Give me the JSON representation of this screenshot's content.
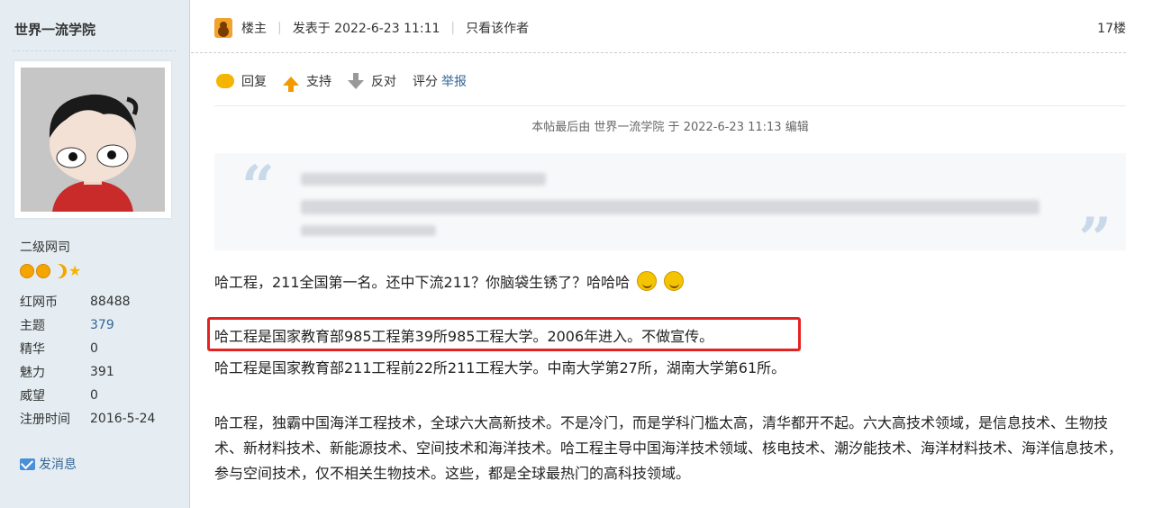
{
  "user": {
    "name": "世界一流学院",
    "level": "二级网司",
    "stats": [
      {
        "label": "红网币",
        "value": "88488"
      },
      {
        "label": "主题",
        "value": "379"
      },
      {
        "label": "精华",
        "value": "0"
      },
      {
        "label": "魅力",
        "value": "391"
      },
      {
        "label": "威望",
        "value": "0"
      },
      {
        "label": "注册时间",
        "value": "2016-5-24"
      }
    ],
    "send_message": "发消息",
    "icons": [
      "sun-icon",
      "sun-icon",
      "moon-icon",
      "star-icon"
    ]
  },
  "post": {
    "author_label": "楼主",
    "posted": "发表于 2022-6-23 11:11",
    "only_author": "只看该作者",
    "floor": "17楼",
    "actions": {
      "reply": "回复",
      "support": "支持",
      "oppose": "反对",
      "rate": "评分",
      "report": "举报"
    },
    "edited_note": "本帖最后由 世界一流学院 于 2022-6-23 11:13 编辑",
    "line1": "哈工程，211全国第一名。还中下流211？你脑袋生锈了？哈哈哈",
    "line2": "哈工程是国家教育部985工程第39所985工程大学。2006年进入。不做宣传。",
    "line3": "哈工程是国家教育部211工程前22所211工程大学。中南大学第27所，湖南大学第61所。",
    "para3": "哈工程，独霸中国海洋工程技术，全球六大高新技术。不是冷门，而是学科门槛太高，清华都开不起。六大高技术领域，是信息技术、生物技术、新材料技术、新能源技术、空间技术和海洋技术。哈工程主导中国海洋技术领域、核电技术、潮汐能技术、海洋材料技术、海洋信息技术，参与空间技术，仅不相关生物技术。这些，都是全球最热门的高科技领域。"
  },
  "colors": {
    "sidebar_bg": "#e5edf2",
    "link": "#336699",
    "highlight_border": "#e52222"
  }
}
